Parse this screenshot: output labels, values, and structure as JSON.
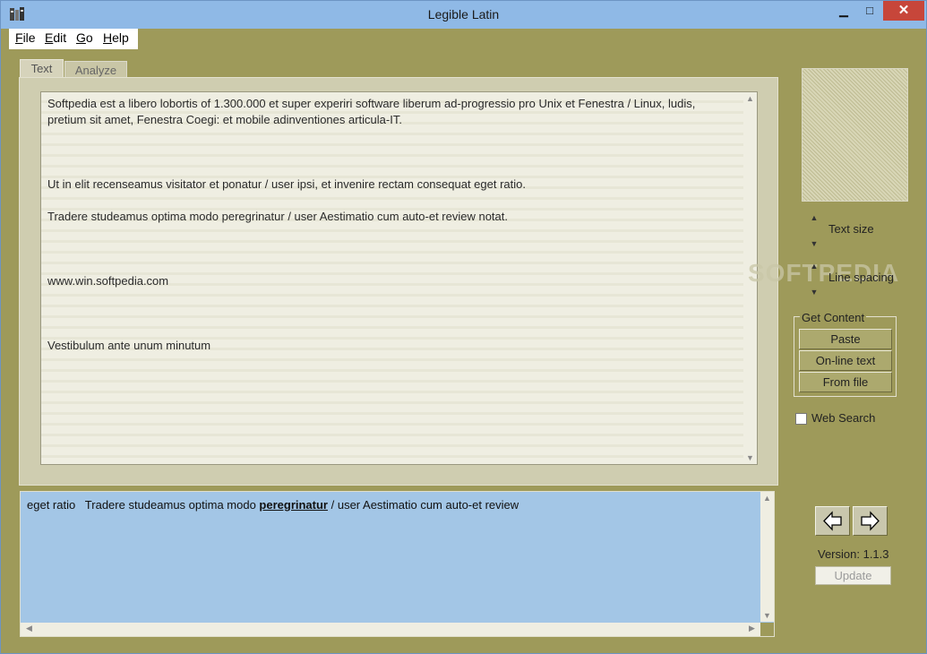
{
  "window": {
    "title": "Legible Latin",
    "controls": {
      "minimize": "▁",
      "maximize": "□",
      "close": "✕"
    }
  },
  "menu": {
    "items": [
      {
        "label": "File",
        "mnemonic": "F",
        "rest": "ile"
      },
      {
        "label": "Edit",
        "mnemonic": "E",
        "rest": "dit"
      },
      {
        "label": "Go",
        "mnemonic": "G",
        "rest": "o"
      },
      {
        "label": "Help",
        "mnemonic": "H",
        "rest": "elp"
      }
    ]
  },
  "tabs": [
    {
      "label": "Text",
      "active": true
    },
    {
      "label": "Analyze",
      "active": false
    }
  ],
  "text_content": {
    "paragraphs": [
      "Softpedia est a libero lobortis of 1.300.000 et super experiri software liberum ad-progressio pro Unix et Fenestra / Linux, ludis, pretium sit amet, Fenestra Coegi: et mobile adinventiones articula-IT.",
      "Ut in elit recenseamus visitator et ponatur / user ipsi, et invenire rectam consequat eget ratio.",
      "Tradere studeamus optima modo peregrinatur / user Aestimatio cum auto-et review notat.",
      "www.win.softpedia.com",
      "Vestibulum ante unum minutum"
    ]
  },
  "side_controls": {
    "text_size_label": "Text size",
    "line_spacing_label": "Line spacing",
    "watermark": "SOFTPEDIA",
    "get_content": {
      "title": "Get Content",
      "buttons": [
        "Paste",
        "On-line text",
        "From file"
      ]
    },
    "web_search_label": "Web Search",
    "web_search_checked": false
  },
  "reading_line": {
    "before": "eget ratio   Tradere studeamus optima modo ",
    "highlight": "peregrinatur",
    "after": " / user Aestimatio cum auto-et review"
  },
  "footer": {
    "version_label": "Version:  1.1.3",
    "update_label": "Update"
  },
  "colors": {
    "window_bg": "#9e9a5a",
    "titlebar": "#8fb9e6",
    "close_button": "#c7463a",
    "reading_panel": "#a3c6e6"
  }
}
